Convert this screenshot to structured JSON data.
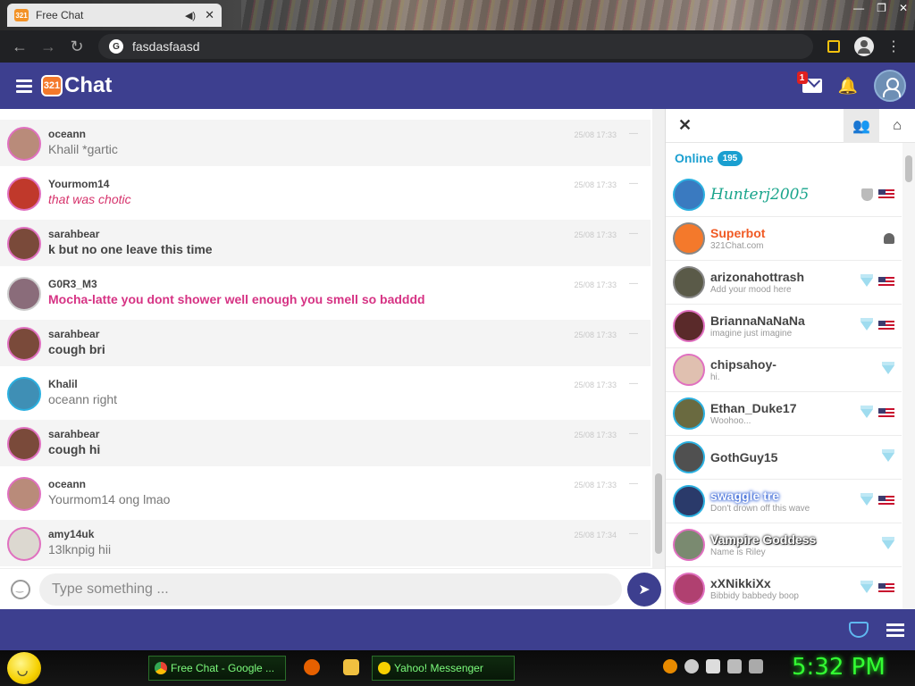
{
  "browser": {
    "tab_title": "Free Chat",
    "tab_favicon": "321",
    "url": "fasdasfaasd"
  },
  "app": {
    "logo_badge": "321",
    "logo_word": "Chat",
    "mail_count": "1"
  },
  "messages": [
    {
      "user": "oceann",
      "text": "Khalil *gartic",
      "time": "25/08 17:33",
      "style": "plain",
      "alt": true,
      "ring": "pink",
      "avatar_color": "#b98b7a"
    },
    {
      "user": "Yourmom14",
      "text": "that was chotic",
      "time": "25/08 17:33",
      "style": "pinkit",
      "alt": false,
      "ring": "pink",
      "avatar_color": "#c0392b"
    },
    {
      "user": "sarahbear",
      "text": "k but no one leave this time",
      "time": "25/08 17:33",
      "style": "bold",
      "alt": true,
      "ring": "pink",
      "avatar_color": "#7a4a3a"
    },
    {
      "user": "G0R3_M3",
      "text": "Mocha-latte you dont shower well enough you smell so badddd",
      "time": "25/08 17:33",
      "style": "magenta",
      "alt": false,
      "ring": "grey",
      "avatar_color": "#8a6c7a"
    },
    {
      "user": "sarahbear",
      "text": "cough bri",
      "time": "25/08 17:33",
      "style": "bold",
      "alt": true,
      "ring": "pink",
      "avatar_color": "#7a4a3a"
    },
    {
      "user": "Khalil",
      "text": "oceann right",
      "time": "25/08 17:33",
      "style": "plain",
      "alt": false,
      "ring": "blue",
      "avatar_color": "#3f8fb5"
    },
    {
      "user": "sarahbear",
      "text": "cough hi",
      "time": "25/08 17:33",
      "style": "bold",
      "alt": true,
      "ring": "pink",
      "avatar_color": "#7a4a3a"
    },
    {
      "user": "oceann",
      "text": "Yourmom14 ong lmao",
      "time": "25/08 17:33",
      "style": "plain",
      "alt": false,
      "ring": "pink",
      "avatar_color": "#b98b7a"
    },
    {
      "user": "amy14uk",
      "text": "13lknpig hii",
      "time": "25/08 17:34",
      "style": "plain",
      "alt": true,
      "ring": "pink",
      "avatar_color": "#dcd8d0"
    }
  ],
  "input": {
    "placeholder": "Type something ..."
  },
  "panel": {
    "online_label": "Online",
    "online_count": "195",
    "users": [
      {
        "name": "Hunterj2005",
        "mood": "",
        "style": "script",
        "ring": "blue",
        "avatar_color": "#3a7ac0",
        "icons": [
          "shield",
          "flag"
        ]
      },
      {
        "name": "Superbot",
        "mood": "321Chat.com",
        "style": "orange",
        "ring": "grey",
        "avatar_color": "#f4792b",
        "icons": [
          "android"
        ]
      },
      {
        "name": "arizonahottrash",
        "mood": "Add your mood here",
        "style": "normal",
        "ring": "grey",
        "avatar_color": "#5a5a48",
        "icons": [
          "diamond",
          "flag"
        ]
      },
      {
        "name": "BriannaNaNaNa",
        "mood": "imagine just imagine",
        "style": "normal",
        "ring": "pink",
        "avatar_color": "#5a2a2a",
        "icons": [
          "diamond",
          "flag"
        ]
      },
      {
        "name": "chipsahoy-",
        "mood": "hi.",
        "style": "normal",
        "ring": "pink",
        "avatar_color": "#e0c0b0",
        "icons": [
          "diamond"
        ]
      },
      {
        "name": "Ethan_Duke17",
        "mood": "Woohoo...",
        "style": "normal",
        "ring": "blue",
        "avatar_color": "#6a6a40",
        "icons": [
          "diamond",
          "flag"
        ]
      },
      {
        "name": "GothGuy15",
        "mood": "",
        "style": "normal",
        "ring": "blue",
        "avatar_color": "#505050",
        "icons": [
          "diamond"
        ]
      },
      {
        "name": "swaggle tre",
        "mood": "Don't drown off this wave",
        "style": "blueglow",
        "ring": "blue",
        "avatar_color": "#2a3a6a",
        "icons": [
          "diamond",
          "flag"
        ]
      },
      {
        "name": "Vampire Goddess",
        "mood": "Name is Riley",
        "style": "glow",
        "ring": "pink",
        "avatar_color": "#7a8a70",
        "icons": [
          "diamond"
        ]
      },
      {
        "name": "xXNikkiXx",
        "mood": "Bibbidy babbedy boop",
        "style": "normal",
        "ring": "pink",
        "avatar_color": "#b04070",
        "icons": [
          "diamond",
          "flag"
        ]
      }
    ]
  },
  "taskbar": {
    "item1": "Free Chat - Google ...",
    "item2": "Yahoo! Messenger",
    "clock": "5:32 PM"
  },
  "icons": {
    "back": "back-arrow-icon",
    "forward": "forward-arrow-icon",
    "reload": "reload-icon",
    "menu": "hamburger-menu-icon",
    "mail": "mail-icon",
    "bell": "bell-icon",
    "send": "send-icon",
    "emoji": "smiley-icon"
  },
  "colors": {
    "header": "#3d3f8f",
    "online": "#1a9fd0",
    "clock": "#33ff33"
  }
}
